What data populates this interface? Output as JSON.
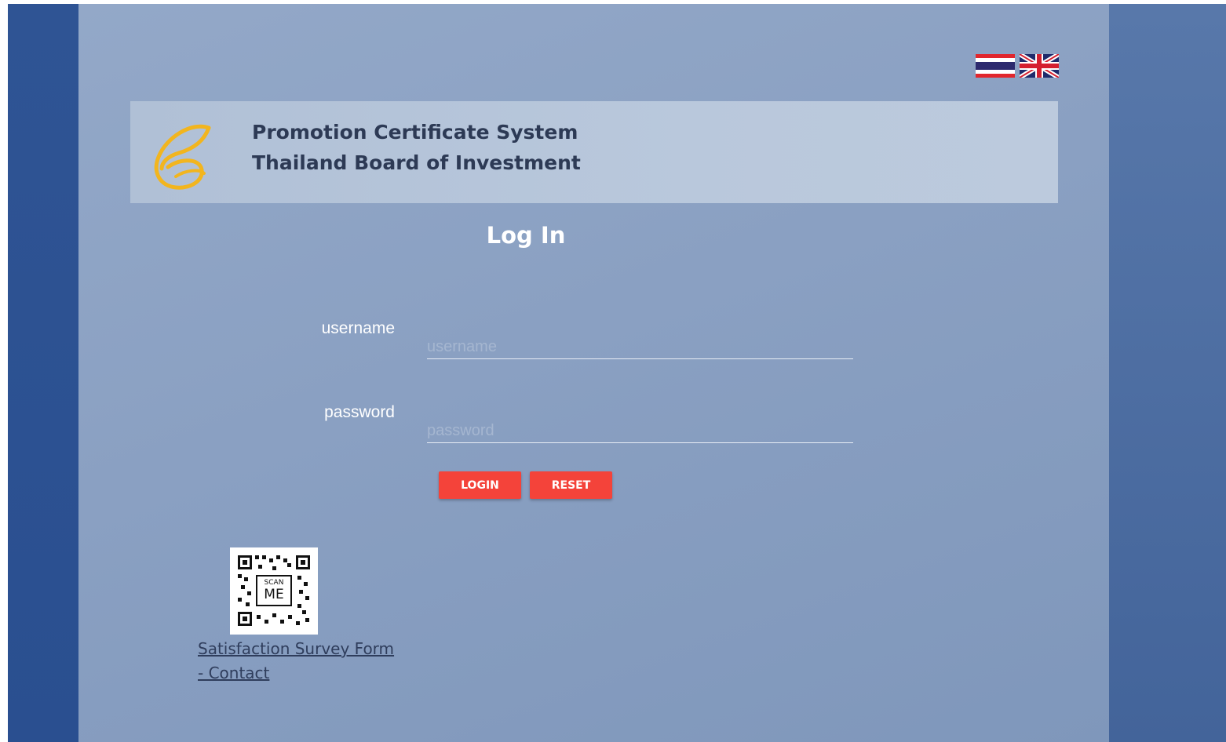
{
  "header": {
    "title_line1": "Promotion Certificate System",
    "title_line2": "Thailand Board of Investment"
  },
  "languages": [
    {
      "name": "thai-flag-icon",
      "code": "th"
    },
    {
      "name": "uk-flag-icon",
      "code": "en"
    }
  ],
  "login": {
    "title": "Log In",
    "username_label": "username",
    "username_placeholder": "username",
    "username_value": "",
    "password_label": "password",
    "password_placeholder": "password",
    "password_value": "",
    "login_button": "LOGIN",
    "reset_button": "RESET"
  },
  "survey": {
    "qr_text_top": "SCAN",
    "qr_text_bottom": "ME",
    "link_line1": "Satisfaction Survey Form",
    "link_line2": "- Contact"
  },
  "colors": {
    "accent_button": "#f4433a",
    "logo_gold": "#f2b51e",
    "header_text": "#2d3a55"
  }
}
